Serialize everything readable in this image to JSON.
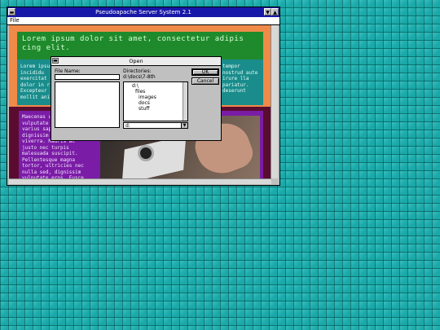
{
  "window": {
    "title": "Pseudoapache Server System 2.1",
    "system_menu_glyph": "▬",
    "minimize_glyph": "▼",
    "maximize_glyph": "▲",
    "menu": [
      "File"
    ]
  },
  "page": {
    "heading": "Lorem ipsum dolor sit amet, consectetur adipis cing elit.",
    "teal_left": "Lorem ipsu incididu exercitat dolor in r Excepteur mollit ani",
    "teal_right": "tempor nostrud aute irure lla pariatur. deserunt",
    "purple_text": "Maecenas u nec sem el vulputate pulvinar. varius sap Integer rh dignissim justo eget viverra. Mauris ac justo nec turpis malesuada suscipit. Pellentesque magna tortor, ultricies nec nulla sed, dignissim vulputate eros. Fusce"
  },
  "dialog": {
    "title": "Open",
    "system_glyph": "▬",
    "file_name_label": "File Name:",
    "file_name_value": "",
    "directories_label": "Directories:",
    "current_path": "d:\\docs\\7-8th",
    "tree": [
      {
        "label": "d:\\",
        "depth": 0
      },
      {
        "label": "files",
        "depth": 1
      },
      {
        "label": "images",
        "depth": 2
      },
      {
        "label": "docs",
        "depth": 2
      },
      {
        "label": "stuff",
        "depth": 2
      }
    ],
    "ok_label": "OK",
    "cancel_label": "Cancel",
    "drive_value": "d:",
    "drive_arrow": "▼"
  },
  "colors": {
    "desktop": "#1aa8a8",
    "titlebar": "#1818a8",
    "green_band": "#1f8a2c",
    "teal_band": "#1a8c8c",
    "orange": "#f08a48",
    "purple": "#7b1ca6"
  }
}
